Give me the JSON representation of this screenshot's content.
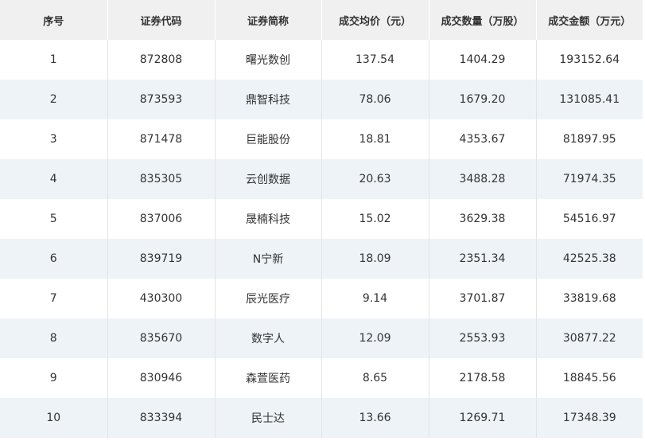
{
  "table": {
    "headers": [
      "序号",
      "证券代码",
      "证券简称",
      "成交均价（元）",
      "成交数量（万股）",
      "成交金额（万元）"
    ],
    "rows": [
      [
        "1",
        "872808",
        "曙光数创",
        "137.54",
        "1404.29",
        "193152.64"
      ],
      [
        "2",
        "873593",
        "鼎智科技",
        "78.06",
        "1679.20",
        "131085.41"
      ],
      [
        "3",
        "871478",
        "巨能股份",
        "18.81",
        "4353.67",
        "81897.95"
      ],
      [
        "4",
        "835305",
        "云创数据",
        "20.63",
        "3488.28",
        "71974.35"
      ],
      [
        "5",
        "837006",
        "晟楠科技",
        "15.02",
        "3629.38",
        "54516.97"
      ],
      [
        "6",
        "839719",
        "N宁新",
        "18.09",
        "2351.34",
        "42525.38"
      ],
      [
        "7",
        "430300",
        "辰光医疗",
        "9.14",
        "3701.87",
        "33819.68"
      ],
      [
        "8",
        "835670",
        "数字人",
        "12.09",
        "2553.93",
        "30877.22"
      ],
      [
        "9",
        "830946",
        "森萱医药",
        "8.65",
        "2178.58",
        "18845.56"
      ],
      [
        "10",
        "833394",
        "民士达",
        "13.66",
        "1269.71",
        "17348.39"
      ]
    ]
  }
}
